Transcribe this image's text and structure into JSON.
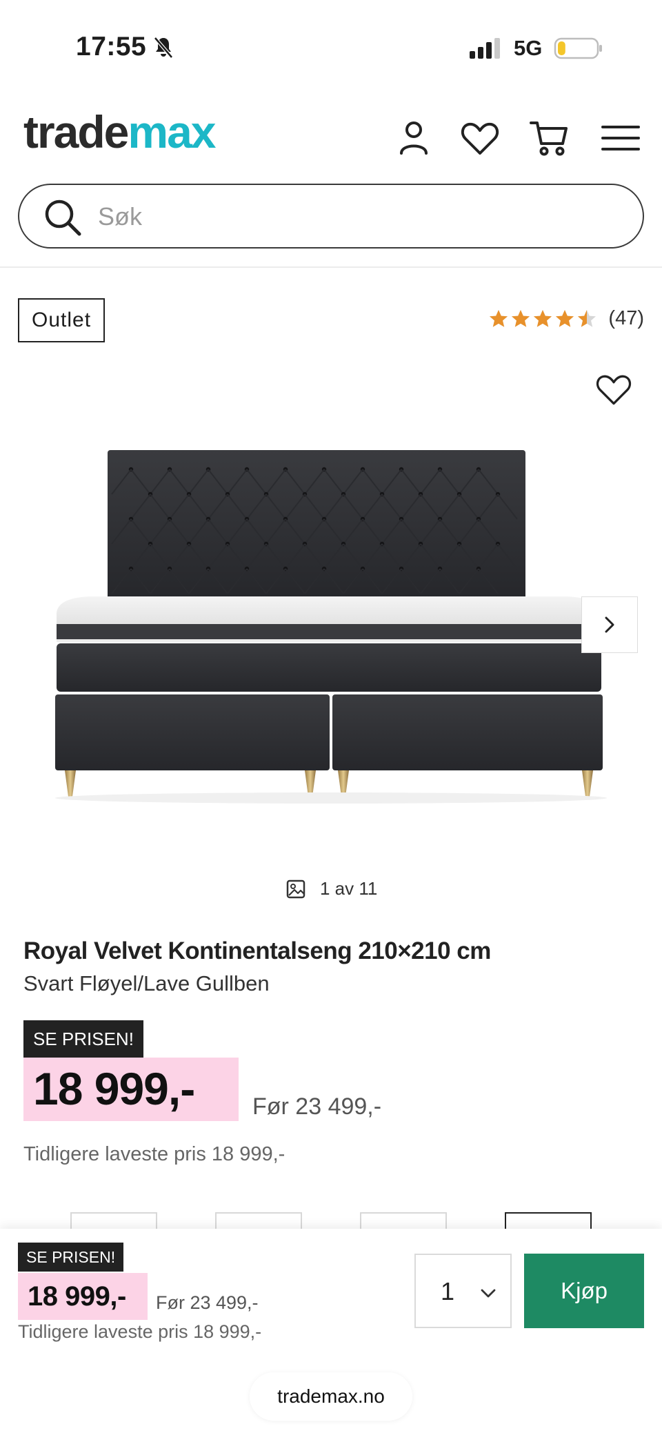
{
  "status_bar": {
    "time": "17:55",
    "network": "5G",
    "battery_level": 0.2
  },
  "header": {
    "logo_part1": "trade",
    "logo_part2": "max",
    "colors": {
      "logo_dark": "#2b2b2b",
      "logo_accent": "#1cb7c7"
    },
    "icons": [
      "account-icon",
      "wishlist-icon",
      "cart-icon",
      "menu-icon"
    ]
  },
  "search": {
    "placeholder": "Søk",
    "value": ""
  },
  "product": {
    "badge": "Outlet",
    "rating": 4.5,
    "rating_max": 5,
    "review_count": "(47)",
    "image_counter": "1 av 11",
    "title": "Royal Velvet Kontinentalseng 210×210 cm",
    "variant": "Svart Fløyel/Lave Gullben",
    "promo_label": "SE PRISEN!",
    "price": "18 999,-",
    "price_before": "Før 23 499,-",
    "lowest_price": "Tidligere laveste pris 18 999,-",
    "colors": {
      "price_highlight": "#fcd3e6",
      "star": "#e8912b"
    }
  },
  "sticky_bar": {
    "promo_label": "SE PRISEN!",
    "price": "18 999,-",
    "price_before": "Før 23 499,-",
    "lowest_price": "Tidligere laveste pris 18 999,-",
    "quantity": "1",
    "buy_label": "Kjøp",
    "colors": {
      "buy_button": "#1e8a63"
    }
  },
  "browser": {
    "url": "trademax.no"
  }
}
